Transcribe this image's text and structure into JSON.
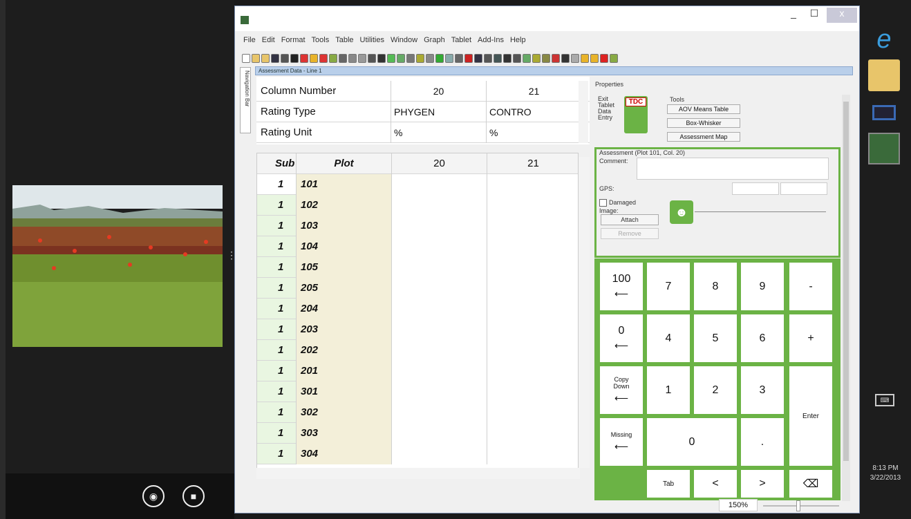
{
  "taskbar": {
    "time": "8:13 PM",
    "date": "3/22/2013"
  },
  "window": {
    "minimize": "_",
    "maximize": "☐",
    "close": "x"
  },
  "menu": [
    "File",
    "Edit",
    "Format",
    "Tools",
    "Table",
    "Utilities",
    "Window",
    "Graph",
    "Tablet",
    "Add-Ins",
    "Help"
  ],
  "nav_bar_label": "Navigation Bar",
  "doc_title": "Assessment Data - Line 1",
  "header_rows": [
    {
      "label": "Column Number",
      "c20": "20",
      "c21": "21"
    },
    {
      "label": "Rating Type",
      "c20": "PHYGEN",
      "c21": "CONTRO"
    },
    {
      "label": "Rating Unit",
      "c20": "%",
      "c21": "%"
    }
  ],
  "grid": {
    "headers": {
      "sub": "Sub",
      "plot": "Plot",
      "c20": "20",
      "c21": "21"
    },
    "rows": [
      {
        "sub": "1",
        "plot": "101"
      },
      {
        "sub": "1",
        "plot": "102"
      },
      {
        "sub": "1",
        "plot": "103"
      },
      {
        "sub": "1",
        "plot": "104"
      },
      {
        "sub": "1",
        "plot": "105"
      },
      {
        "sub": "1",
        "plot": "205"
      },
      {
        "sub": "1",
        "plot": "204"
      },
      {
        "sub": "1",
        "plot": "203"
      },
      {
        "sub": "1",
        "plot": "202"
      },
      {
        "sub": "1",
        "plot": "201"
      },
      {
        "sub": "1",
        "plot": "301"
      },
      {
        "sub": "1",
        "plot": "302"
      },
      {
        "sub": "1",
        "plot": "303"
      },
      {
        "sub": "1",
        "plot": "304"
      }
    ]
  },
  "properties": {
    "title": "Properties",
    "exit_label": "Exit Tablet Data Entry",
    "tdc_logo": "TDC",
    "tools_label": "Tools",
    "aov_button": "AOV Means Table",
    "box_button": "Box-Whisker",
    "map_button": "Assessment Map",
    "assessment_title": "Assessment (Plot 101, Col. 20)",
    "comment_label": "Comment:",
    "gps_label": "GPS:",
    "damaged_label": "Damaged",
    "image_label": "Image:",
    "attach_button": "Attach",
    "remove_button": "Remove"
  },
  "keypad": {
    "k100": "100",
    "k0": "0",
    "copy": "Copy Down",
    "missing": "Missing",
    "k7": "7",
    "k8": "8",
    "k9": "9",
    "minus": "-",
    "k4": "4",
    "k5": "5",
    "k6": "6",
    "plus": "+",
    "k1": "1",
    "k2": "2",
    "k3": "3",
    "enter": "Enter",
    "kzero": "0",
    "dot": ".",
    "tab": "Tab",
    "lt": "<",
    "gt": ">",
    "back": "⌫"
  },
  "zoom": {
    "level": "150%"
  },
  "colors": {
    "accent_green": "#6bb345",
    "row_green": "#e9f6e1",
    "plot_tan": "#f3efd9"
  }
}
